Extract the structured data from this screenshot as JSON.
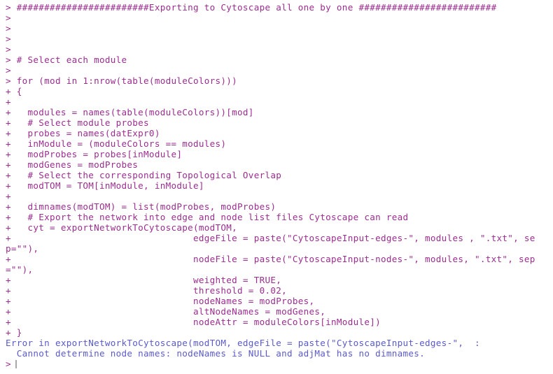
{
  "window": {
    "app": "R Console",
    "background_color": "#ffffff",
    "command_color": "#9B2D8F",
    "error_color": "#5A5ACB",
    "cursor_color": "#a9a9a9"
  },
  "console": {
    "prompt_symbol": ">",
    "continuation_symbol": "+",
    "lines": [
      {
        "type": "command",
        "text": "> ########################Exporting to Cytoscape all one by one #########################"
      },
      {
        "type": "command",
        "text": ">"
      },
      {
        "type": "command",
        "text": ">"
      },
      {
        "type": "command",
        "text": ">"
      },
      {
        "type": "command",
        "text": ">"
      },
      {
        "type": "command",
        "text": "> # Select each module"
      },
      {
        "type": "command",
        "text": ">"
      },
      {
        "type": "command",
        "text": "> for (mod in 1:nrow(table(moduleColors)))"
      },
      {
        "type": "command",
        "text": "+ {"
      },
      {
        "type": "command",
        "text": "+"
      },
      {
        "type": "command",
        "text": "+   modules = names(table(moduleColors))[mod]"
      },
      {
        "type": "command",
        "text": "+   # Select module probes"
      },
      {
        "type": "command",
        "text": "+   probes = names(datExpr0)"
      },
      {
        "type": "command",
        "text": "+   inModule = (moduleColors == modules)"
      },
      {
        "type": "command",
        "text": "+   modProbes = probes[inModule]"
      },
      {
        "type": "command",
        "text": "+   modGenes = modProbes"
      },
      {
        "type": "command",
        "text": "+   # Select the corresponding Topological Overlap"
      },
      {
        "type": "command",
        "text": "+   modTOM = TOM[inModule, inModule]"
      },
      {
        "type": "command",
        "text": "+"
      },
      {
        "type": "command",
        "text": "+   dimnames(modTOM) = list(modProbes, modProbes)"
      },
      {
        "type": "command",
        "text": "+   # Export the network into edge and node list files Cytoscape can read"
      },
      {
        "type": "command",
        "text": "+   cyt = exportNetworkToCytoscape(modTOM,"
      },
      {
        "type": "command",
        "text": "+                                 edgeFile = paste(\"CytoscapeInput-edges-\", modules , \".txt\", se"
      },
      {
        "type": "command",
        "text": "p=\"\"),"
      },
      {
        "type": "command",
        "text": "+                                 nodeFile = paste(\"CytoscapeInput-nodes-\", modules, \".txt\", sep"
      },
      {
        "type": "command",
        "text": "=\"\"),"
      },
      {
        "type": "command",
        "text": "+                                 weighted = TRUE,"
      },
      {
        "type": "command",
        "text": "+                                 threshold = 0.02,"
      },
      {
        "type": "command",
        "text": "+                                 nodeNames = modProbes,"
      },
      {
        "type": "command",
        "text": "+                                 altNodeNames = modGenes,"
      },
      {
        "type": "command",
        "text": "+                                 nodeAttr = moduleColors[inModule])"
      },
      {
        "type": "command",
        "text": "+ }"
      },
      {
        "type": "error",
        "text": "Error in exportNetworkToCytoscape(modTOM, edgeFile = paste(\"CytoscapeInput-edges-\",  :"
      },
      {
        "type": "error",
        "text": "  Cannot determine node names: nodeNames is NULL and adjMat has no dimnames."
      }
    ],
    "final_prompt": ">"
  }
}
